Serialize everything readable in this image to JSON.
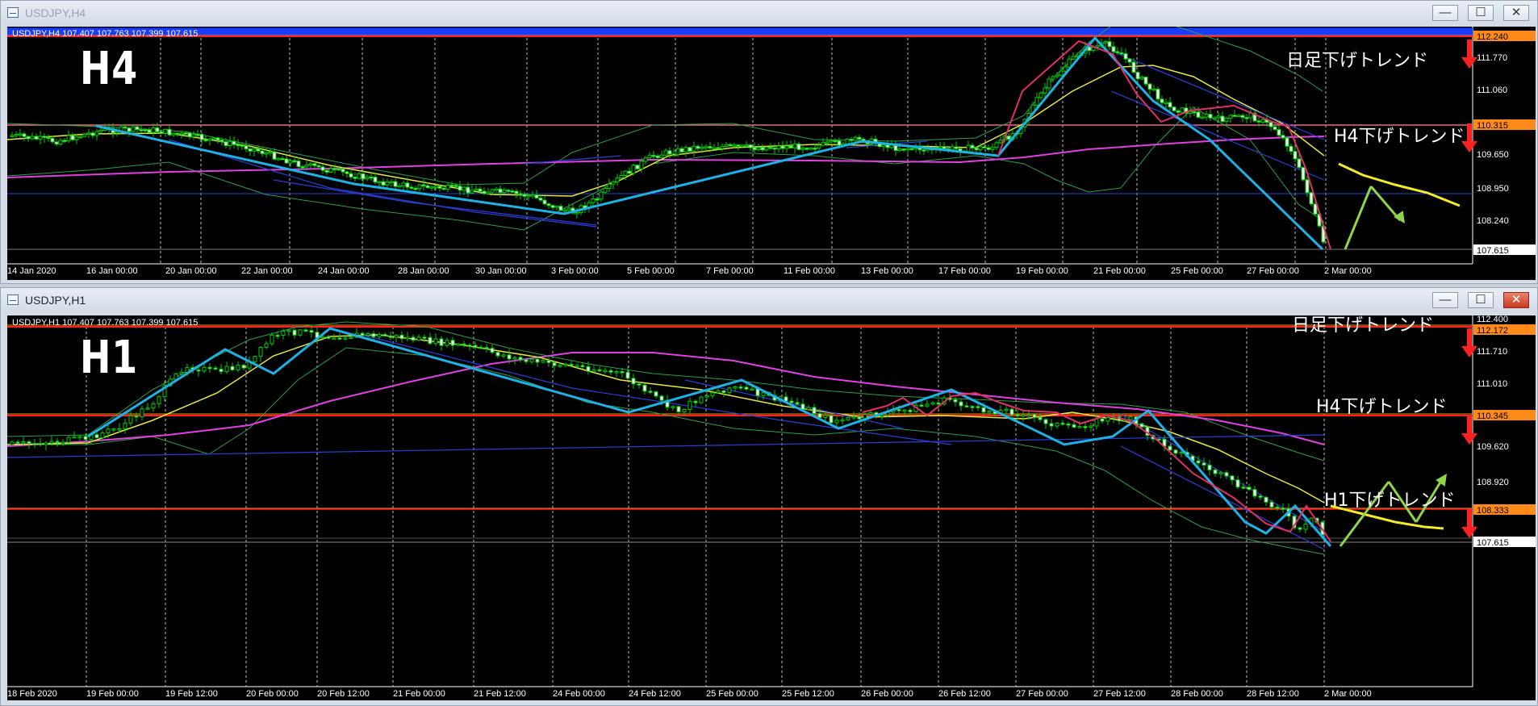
{
  "windows": [
    {
      "title": "USDJPY,H4",
      "info": "USDJPY,H4  107.407 107.763 107.399 107.615",
      "timeframe_label": "H4",
      "price_axis": [
        "112.240",
        "111.770",
        "111.060",
        "110.315",
        "109.650",
        "108.950",
        "108.240",
        "107.615"
      ],
      "time_axis": [
        "14 Jan 2020",
        "16 Jan 00:00",
        "20 Jan 00:00",
        "22 Jan 00:00",
        "24 Jan 00:00",
        "28 Jan 00:00",
        "30 Jan 00:00",
        "3 Feb 00:00",
        "5 Feb 00:00",
        "7 Feb 00:00",
        "11 Feb 00:00",
        "13 Feb 00:00",
        "17 Feb 00:00",
        "19 Feb 00:00",
        "21 Feb 00:00",
        "25 Feb 00:00",
        "27 Feb 00:00",
        "2 Mar 00:00"
      ],
      "trend_labels": [
        "日足下げトレンド",
        "H4下げトレンド"
      ],
      "levels": [
        "112.240",
        "110.315",
        "107.615"
      ]
    },
    {
      "title": "USDJPY,H1",
      "info": "USDJPY,H1  107.407 107.763 107.399 107.615",
      "timeframe_label": "H1",
      "price_axis": [
        "112.400",
        "112.172",
        "111.710",
        "111.010",
        "110.345",
        "109.620",
        "108.920",
        "108.333",
        "107.615"
      ],
      "time_axis": [
        "18 Feb 2020",
        "19 Feb 00:00",
        "19 Feb 12:00",
        "20 Feb 00:00",
        "20 Feb 12:00",
        "21 Feb 00:00",
        "21 Feb 12:00",
        "24 Feb 00:00",
        "24 Feb 12:00",
        "25 Feb 00:00",
        "25 Feb 12:00",
        "26 Feb 00:00",
        "26 Feb 12:00",
        "27 Feb 00:00",
        "27 Feb 12:00",
        "28 Feb 00:00",
        "28 Feb 12:00",
        "2 Mar 00:00"
      ],
      "trend_labels": [
        "日足下げトレンド",
        "H4下げトレンド",
        "H1下げトレンド"
      ],
      "levels": [
        "112.172",
        "110.345",
        "108.333",
        "107.615"
      ]
    }
  ],
  "buttons": {
    "minimize": "—",
    "maximize": "☐",
    "close": "✕"
  },
  "colors": {
    "background": "#000000",
    "bull": "#00cc00",
    "zigzag": "#1fb0e6",
    "ma_slow": "#e040e0",
    "ma_fast": "#e6e645",
    "resistance": "#ff2020",
    "arrow_down": "#ff2020",
    "arrow_up": "#8fd44a",
    "level_badge": "#ff8a1a"
  },
  "icons": {
    "window": "chart-window-icon",
    "down": "down-arrow-icon",
    "up": "up-arrow-icon"
  }
}
